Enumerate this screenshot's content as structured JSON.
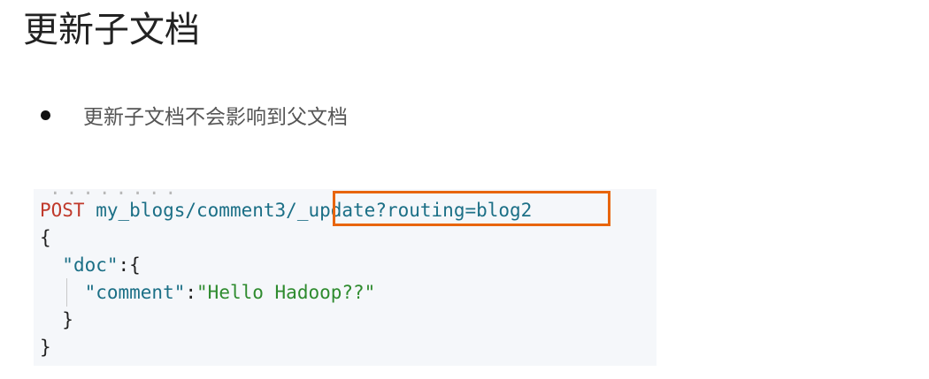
{
  "title": "更新子文档",
  "bullet": "更新子文档不会影响到父文档",
  "code": {
    "top_cut": "........",
    "method": "POST",
    "path_prefix": "my_blogs/comment3/",
    "path_highlight": "_update?routing=blog2",
    "open_brace": "{",
    "doc_key": "\"doc\"",
    "doc_colon_brace": ":{",
    "comment_key": "\"comment\"",
    "comment_colon": ":",
    "comment_value": "\"Hello Hadoop??\"",
    "inner_close": "}",
    "outer_close": "}"
  },
  "colors": {
    "highlight_border": "#e8650d",
    "method": "#c0392b",
    "path": "#1b6f86",
    "string": "#2e8b2e",
    "code_background": "#f5f7fa"
  }
}
